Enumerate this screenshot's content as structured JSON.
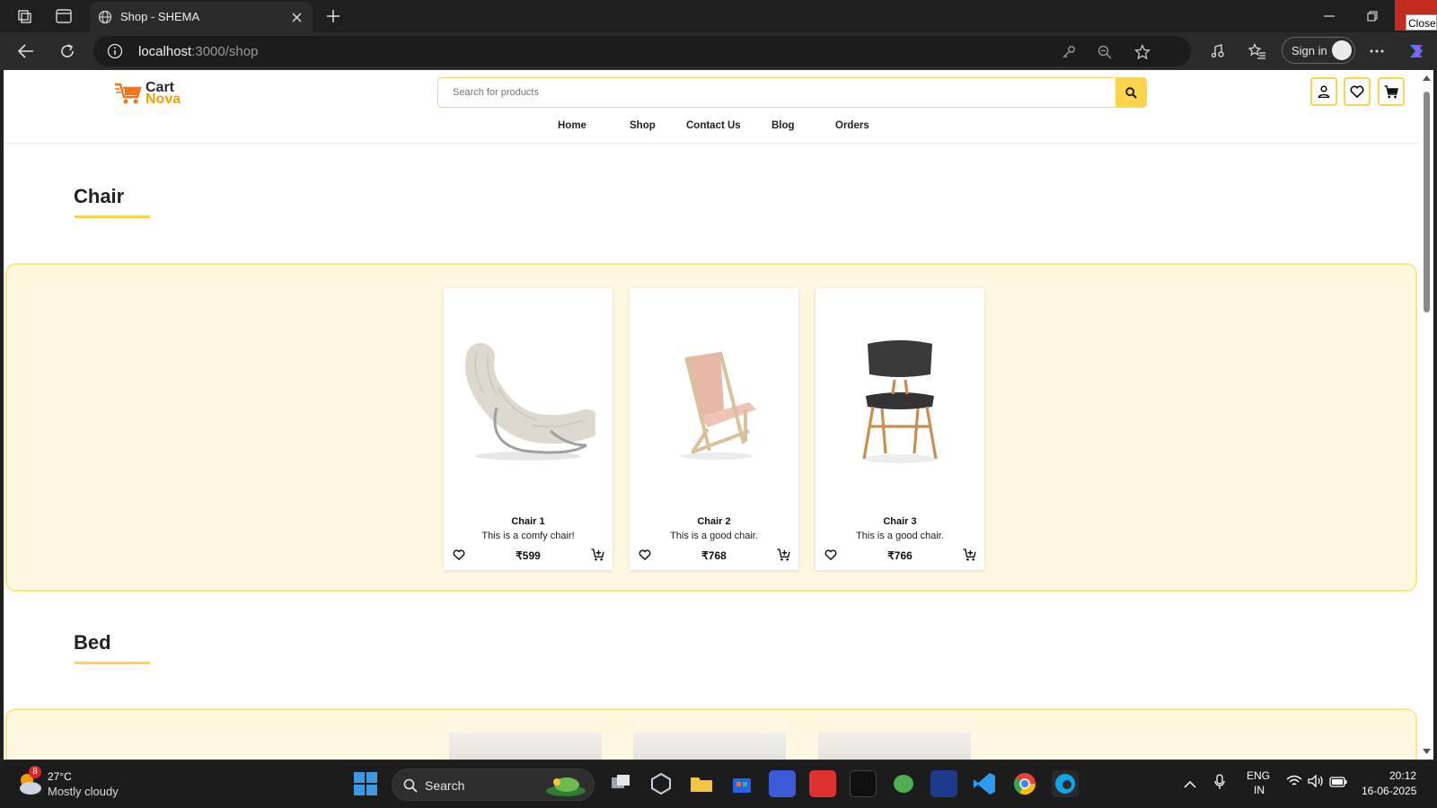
{
  "browser": {
    "tab_title": "Shop - SHEMA",
    "url_host": "localhost",
    "url_path": ":3000/shop",
    "sign_in_label": "Sign in",
    "close_tooltip": "Close"
  },
  "site": {
    "logo_line1": "Cart",
    "logo_line2": "Nova",
    "search_placeholder": "Search for products",
    "nav": [
      "Home",
      "Shop",
      "Contact Us",
      "Blog",
      "Orders"
    ],
    "accent_color": "#fcd34d"
  },
  "sections": [
    {
      "title": "Chair",
      "products": [
        {
          "name": "Chair 1",
          "description": "This is a comfy chair!",
          "price": "₹599"
        },
        {
          "name": "Chair 2",
          "description": "This is a good chair.",
          "price": "₹768"
        },
        {
          "name": "Chair 3",
          "description": "This is a good chair.",
          "price": "₹766"
        }
      ]
    },
    {
      "title": "Bed",
      "products": []
    }
  ],
  "taskbar": {
    "weather_badge": "8",
    "weather_temp": "27°C",
    "weather_desc": "Mostly cloudy",
    "search_label": "Search",
    "lang_line1": "ENG",
    "lang_line2": "IN",
    "time": "20:12",
    "date": "16-06-2025"
  }
}
